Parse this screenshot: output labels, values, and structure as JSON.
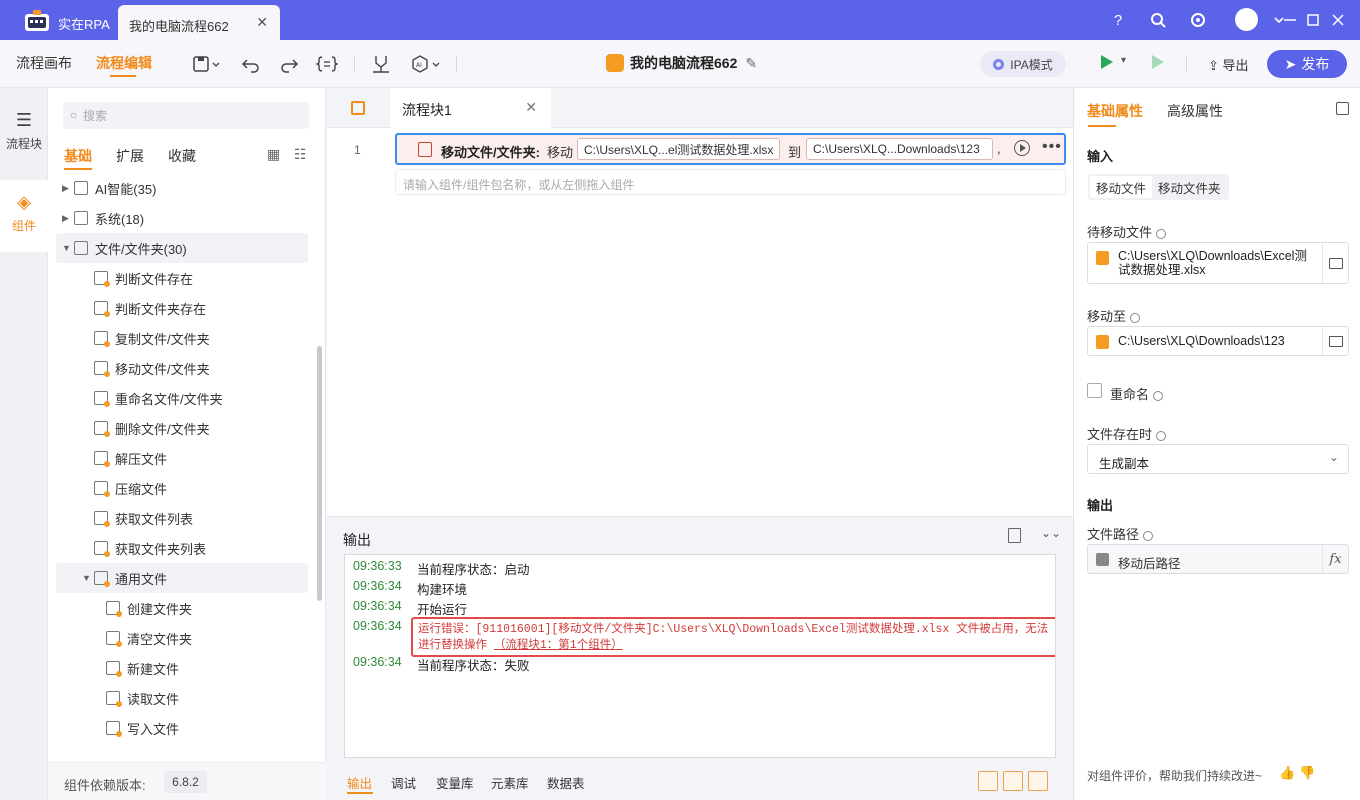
{
  "app": {
    "name": "实在RPA",
    "doc_tab": "我的电脑流程662"
  },
  "toolbar": {
    "mode_tabs": [
      "流程画布",
      "流程编辑"
    ],
    "flow_title": "我的电脑流程662",
    "ipa_label": "IPA模式",
    "export_label": "导出",
    "publish_label": "发布"
  },
  "rail": {
    "items": [
      "流程块",
      "组件"
    ]
  },
  "components": {
    "search_placeholder": "搜索",
    "tabs": [
      "基础",
      "扩展",
      "收藏"
    ],
    "tree": [
      {
        "label": "AI智能(35)",
        "level": 0,
        "arrow": "▶"
      },
      {
        "label": "系统(18)",
        "level": 0,
        "arrow": "▶"
      },
      {
        "label": "文件/文件夹(30)",
        "level": 0,
        "arrow": "▼"
      },
      {
        "label": "判断文件存在",
        "level": 1
      },
      {
        "label": "判断文件夹存在",
        "level": 1
      },
      {
        "label": "复制文件/文件夹",
        "level": 1
      },
      {
        "label": "移动文件/文件夹",
        "level": 1
      },
      {
        "label": "重命名文件/文件夹",
        "level": 1
      },
      {
        "label": "删除文件/文件夹",
        "level": 1
      },
      {
        "label": "解压文件",
        "level": 1
      },
      {
        "label": "压缩文件",
        "level": 1
      },
      {
        "label": "获取文件列表",
        "level": 1
      },
      {
        "label": "获取文件夹列表",
        "level": 1
      },
      {
        "label": "通用文件",
        "level": 1,
        "arrow": "▼"
      },
      {
        "label": "创建文件夹",
        "level": 2
      },
      {
        "label": "清空文件夹",
        "level": 2
      },
      {
        "label": "新建文件",
        "level": 2
      },
      {
        "label": "读取文件",
        "level": 2
      },
      {
        "label": "写入文件",
        "level": 2
      }
    ],
    "dep_label": "组件依赖版本:",
    "dep_version": "6.8.2"
  },
  "editor": {
    "tab_title": "流程块1",
    "line_number": "1",
    "step": {
      "label": "移动文件/文件夹:",
      "verb": "移动",
      "source": "C:\\Users\\XLQ...el测试数据处理.xlsx",
      "to": "到",
      "target": "C:\\Users\\XLQ...Downloads\\123",
      "comma": ","
    },
    "drop_hint": "请输入组件/组件包名称，或从左侧拖入组件"
  },
  "output": {
    "title": "输出",
    "logs": [
      {
        "time": "09:36:33",
        "msg": "当前程序状态：启动"
      },
      {
        "time": "09:36:34",
        "msg": "构建环境"
      },
      {
        "time": "09:36:34",
        "msg": "开始运行"
      },
      {
        "time": "09:36:34",
        "msg": ""
      },
      {
        "time": "09:36:34",
        "msg": "当前程序状态：失败"
      }
    ],
    "error_text": "运行错误：[911016001][移动文件/文件夹]C:\\Users\\XLQ\\Downloads\\Excel测试数据处理.xlsx 文件被占用，无法进行替换操作",
    "error_link": "（流程块1：第1个组件）",
    "tabs": [
      "输出",
      "调试",
      "变量库",
      "元素库",
      "数据表"
    ]
  },
  "props": {
    "tabs": [
      "基础属性",
      "高级属性"
    ],
    "input_section": "输入",
    "seg": [
      "移动文件",
      "移动文件夹"
    ],
    "source_label": "待移动文件",
    "source_value": "C:\\Users\\XLQ\\Downloads\\Excel测试数据处理.xlsx",
    "target_label": "移动至",
    "target_value": "C:\\Users\\XLQ\\Downloads\\123",
    "rename_label": "重命名",
    "exists_label": "文件存在时",
    "exists_value": "生成副本",
    "output_section": "输出",
    "path_label": "文件路径",
    "path_value": "移动后路径",
    "fx": "fx",
    "feedback": "对组件评价，帮助我们持续改进~"
  }
}
